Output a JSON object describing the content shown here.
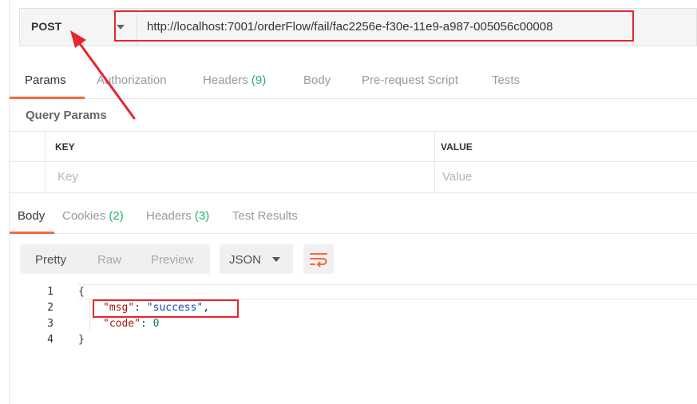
{
  "request": {
    "method": "POST",
    "url": "http://localhost:7001/orderFlow/fail/fac2256e-f30e-11e9-a987-005056c00008"
  },
  "request_tabs": {
    "params": "Params",
    "authorization": "Authorization",
    "headers": "Headers",
    "headers_count": "(9)",
    "body": "Body",
    "prerequest": "Pre-request Script",
    "tests": "Tests"
  },
  "query_params": {
    "title": "Query Params",
    "columns": [
      "KEY",
      "VALUE"
    ],
    "placeholders": [
      "Key",
      "Value"
    ]
  },
  "response_tabs": {
    "body": "Body",
    "cookies": "Cookies",
    "cookies_count": "(2)",
    "headers": "Headers",
    "headers_count": "(3)",
    "test_results": "Test Results"
  },
  "response_toolbar": {
    "pretty": "Pretty",
    "raw": "Raw",
    "preview": "Preview",
    "format": "JSON",
    "wrap_icon": "wrap-lines-icon"
  },
  "response_body": {
    "line_numbers": [
      "1",
      "2",
      "3",
      "4"
    ],
    "open_brace": "{",
    "close_brace": "}",
    "msg_key": "\"msg\"",
    "msg_value": "\"success\"",
    "code_key": "\"code\"",
    "code_value": "0",
    "colon": ": ",
    "comma": ","
  },
  "colors": {
    "accent": "#f26b3a",
    "count_green": "#26b36c",
    "annotation_red": "#e8262b"
  }
}
